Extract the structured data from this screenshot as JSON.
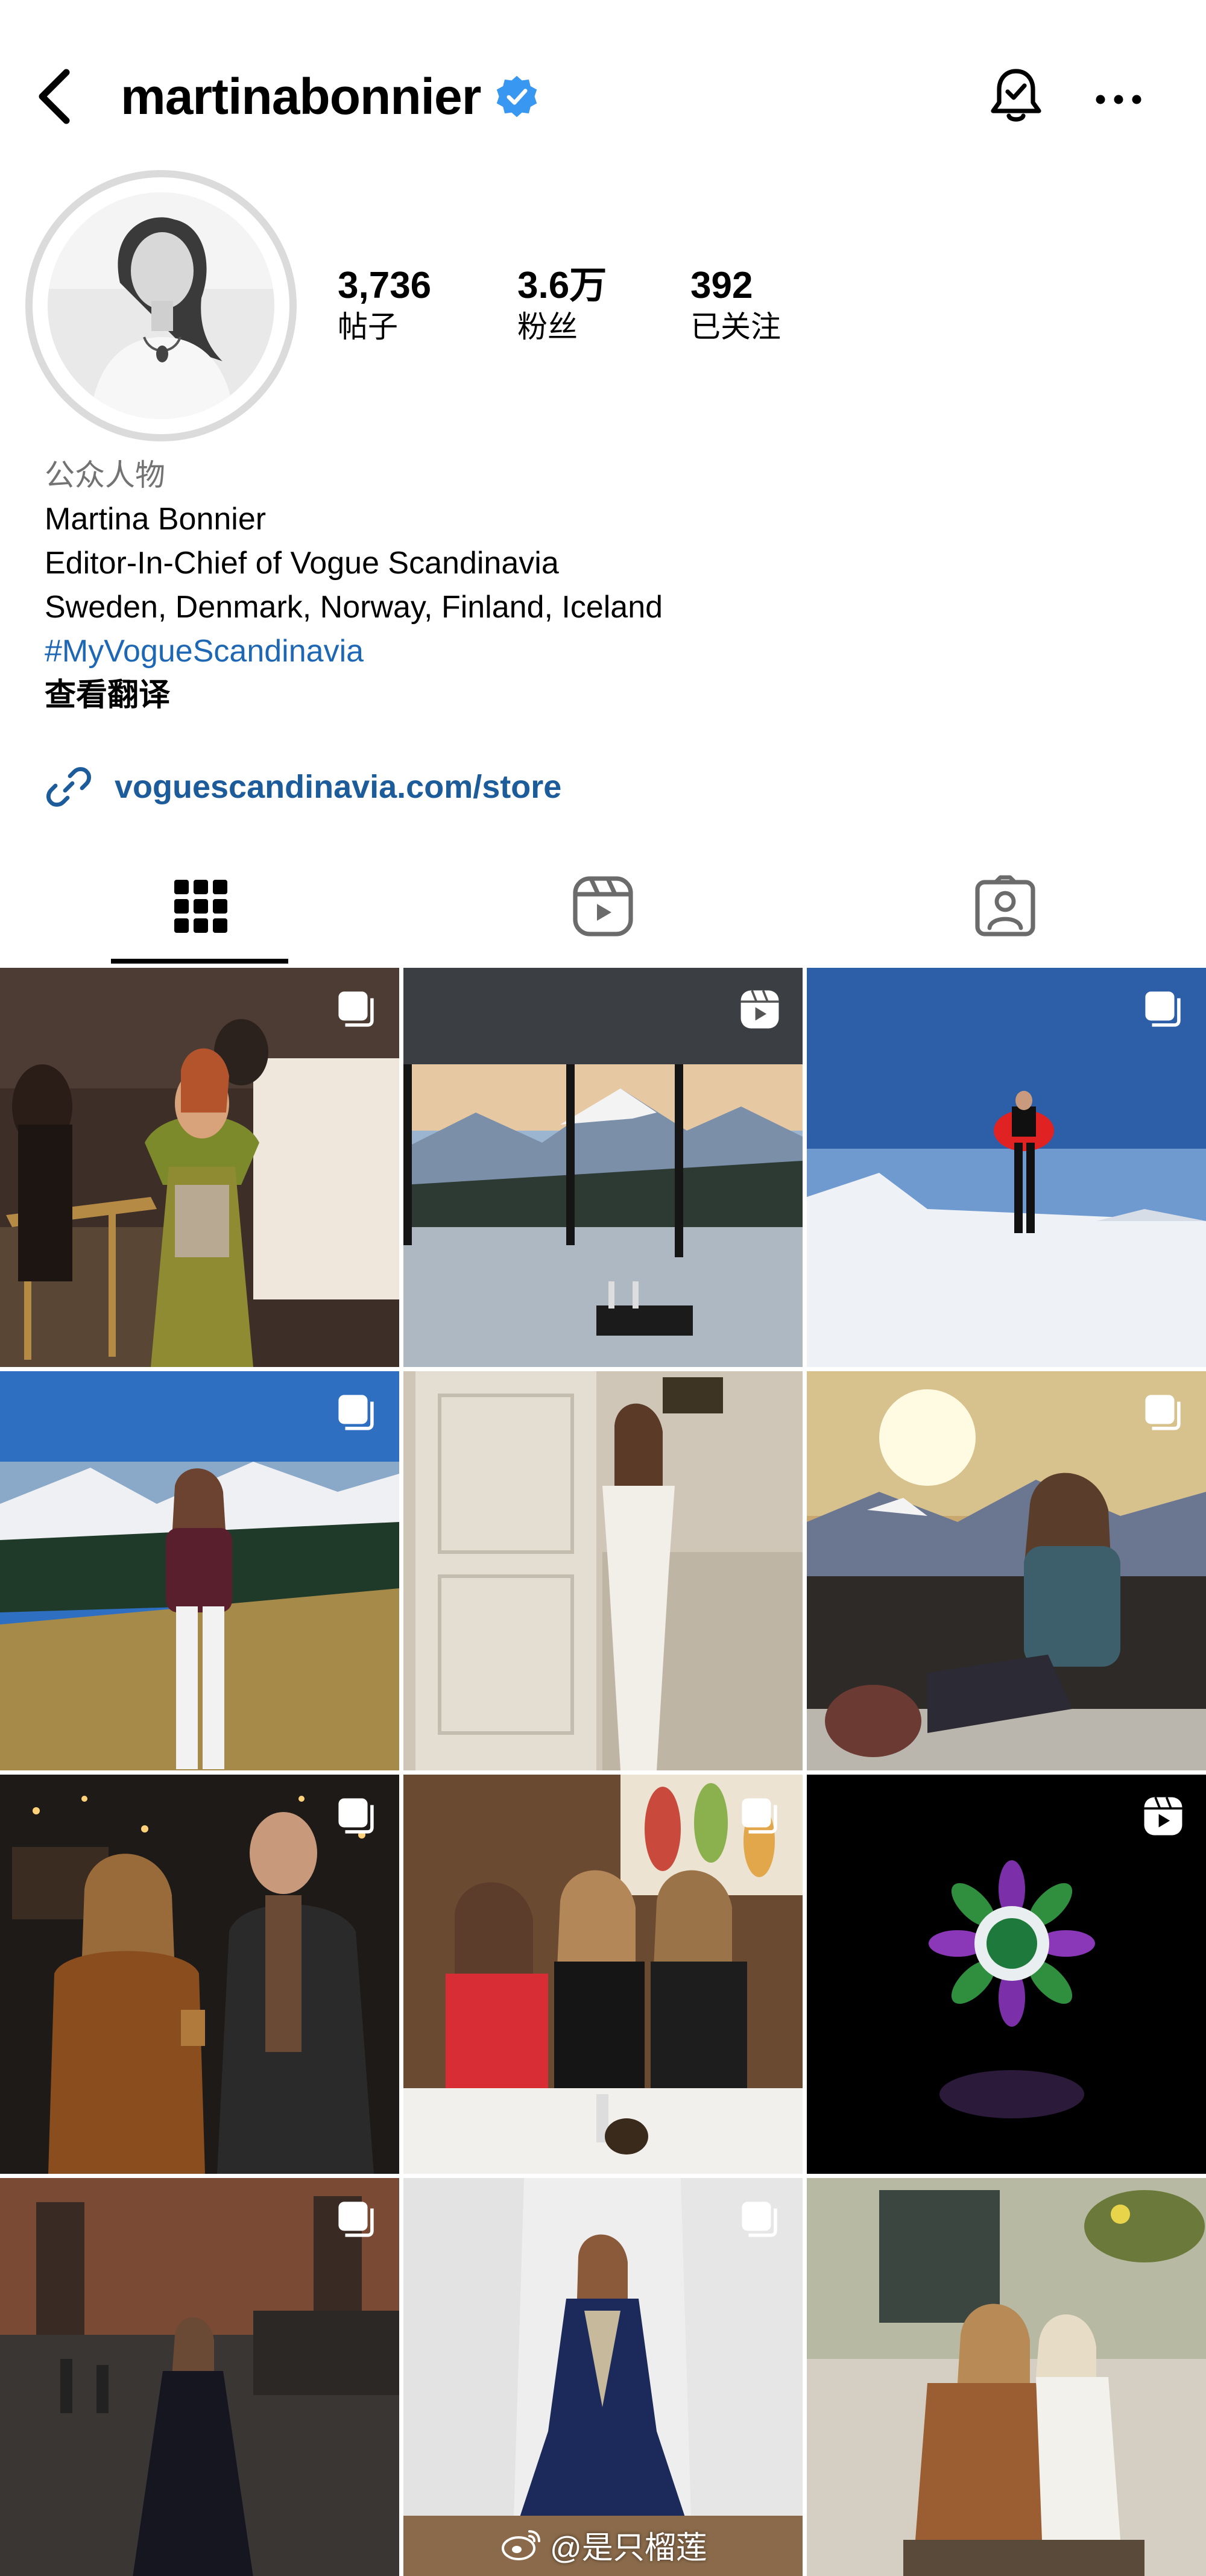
{
  "header": {
    "username": "martinabonnier",
    "verified_icon": "verified-badge-icon",
    "back_icon": "back-arrow-icon",
    "bell_icon": "notification-bell-icon",
    "more_icon": "more-options-icon"
  },
  "stats": [
    {
      "value": "3,736",
      "label": "帖子"
    },
    {
      "value": "3.6万",
      "label": "粉丝"
    },
    {
      "value": "392",
      "label": "已关注"
    }
  ],
  "bio": {
    "category": "公众人物",
    "name": "Martina Bonnier",
    "title": "Editor-In-Chief of Vogue Scandinavia",
    "countries": "Sweden, Denmark, Norway, Finland, Iceland",
    "hashtag": "#MyVogueScandinavia",
    "translate": "查看翻译"
  },
  "link": {
    "icon": "link-icon",
    "text": "voguescandinavia.com/store"
  },
  "tabs": [
    {
      "name": "posts",
      "icon": "grid-icon",
      "active": true
    },
    {
      "name": "reels",
      "icon": "reels-icon",
      "active": false
    },
    {
      "name": "tagged",
      "icon": "tagged-user-icon",
      "active": false
    }
  ],
  "grid": [
    {
      "subject": "gala dinner green gown",
      "badge": "carousel-icon"
    },
    {
      "subject": "mountain view window",
      "badge": "reels-icon"
    },
    {
      "subject": "snow mountain red jacket",
      "badge": "carousel-icon"
    },
    {
      "subject": "mountain meadow sweater",
      "badge": "carousel-icon"
    },
    {
      "subject": "white strapless dress",
      "badge": ""
    },
    {
      "subject": "sunset mountain sitting",
      "badge": "carousel-icon"
    },
    {
      "subject": "night city couple",
      "badge": "carousel-icon"
    },
    {
      "subject": "dinner three women",
      "badge": "carousel-icon"
    },
    {
      "subject": "jewel brooch",
      "badge": "reels-icon"
    },
    {
      "subject": "castle hall gown",
      "badge": "carousel-icon"
    },
    {
      "subject": "navy gown white drape",
      "badge": "carousel-icon"
    },
    {
      "subject": "garden two women",
      "badge": ""
    }
  ],
  "watermark": {
    "icon": "weibo-icon",
    "text": "@是只榴莲"
  },
  "colors": {
    "link": "#1d5c9a",
    "hashtag": "#1d67b5",
    "verified": "#3897f0",
    "secondary_text": "#737373"
  }
}
